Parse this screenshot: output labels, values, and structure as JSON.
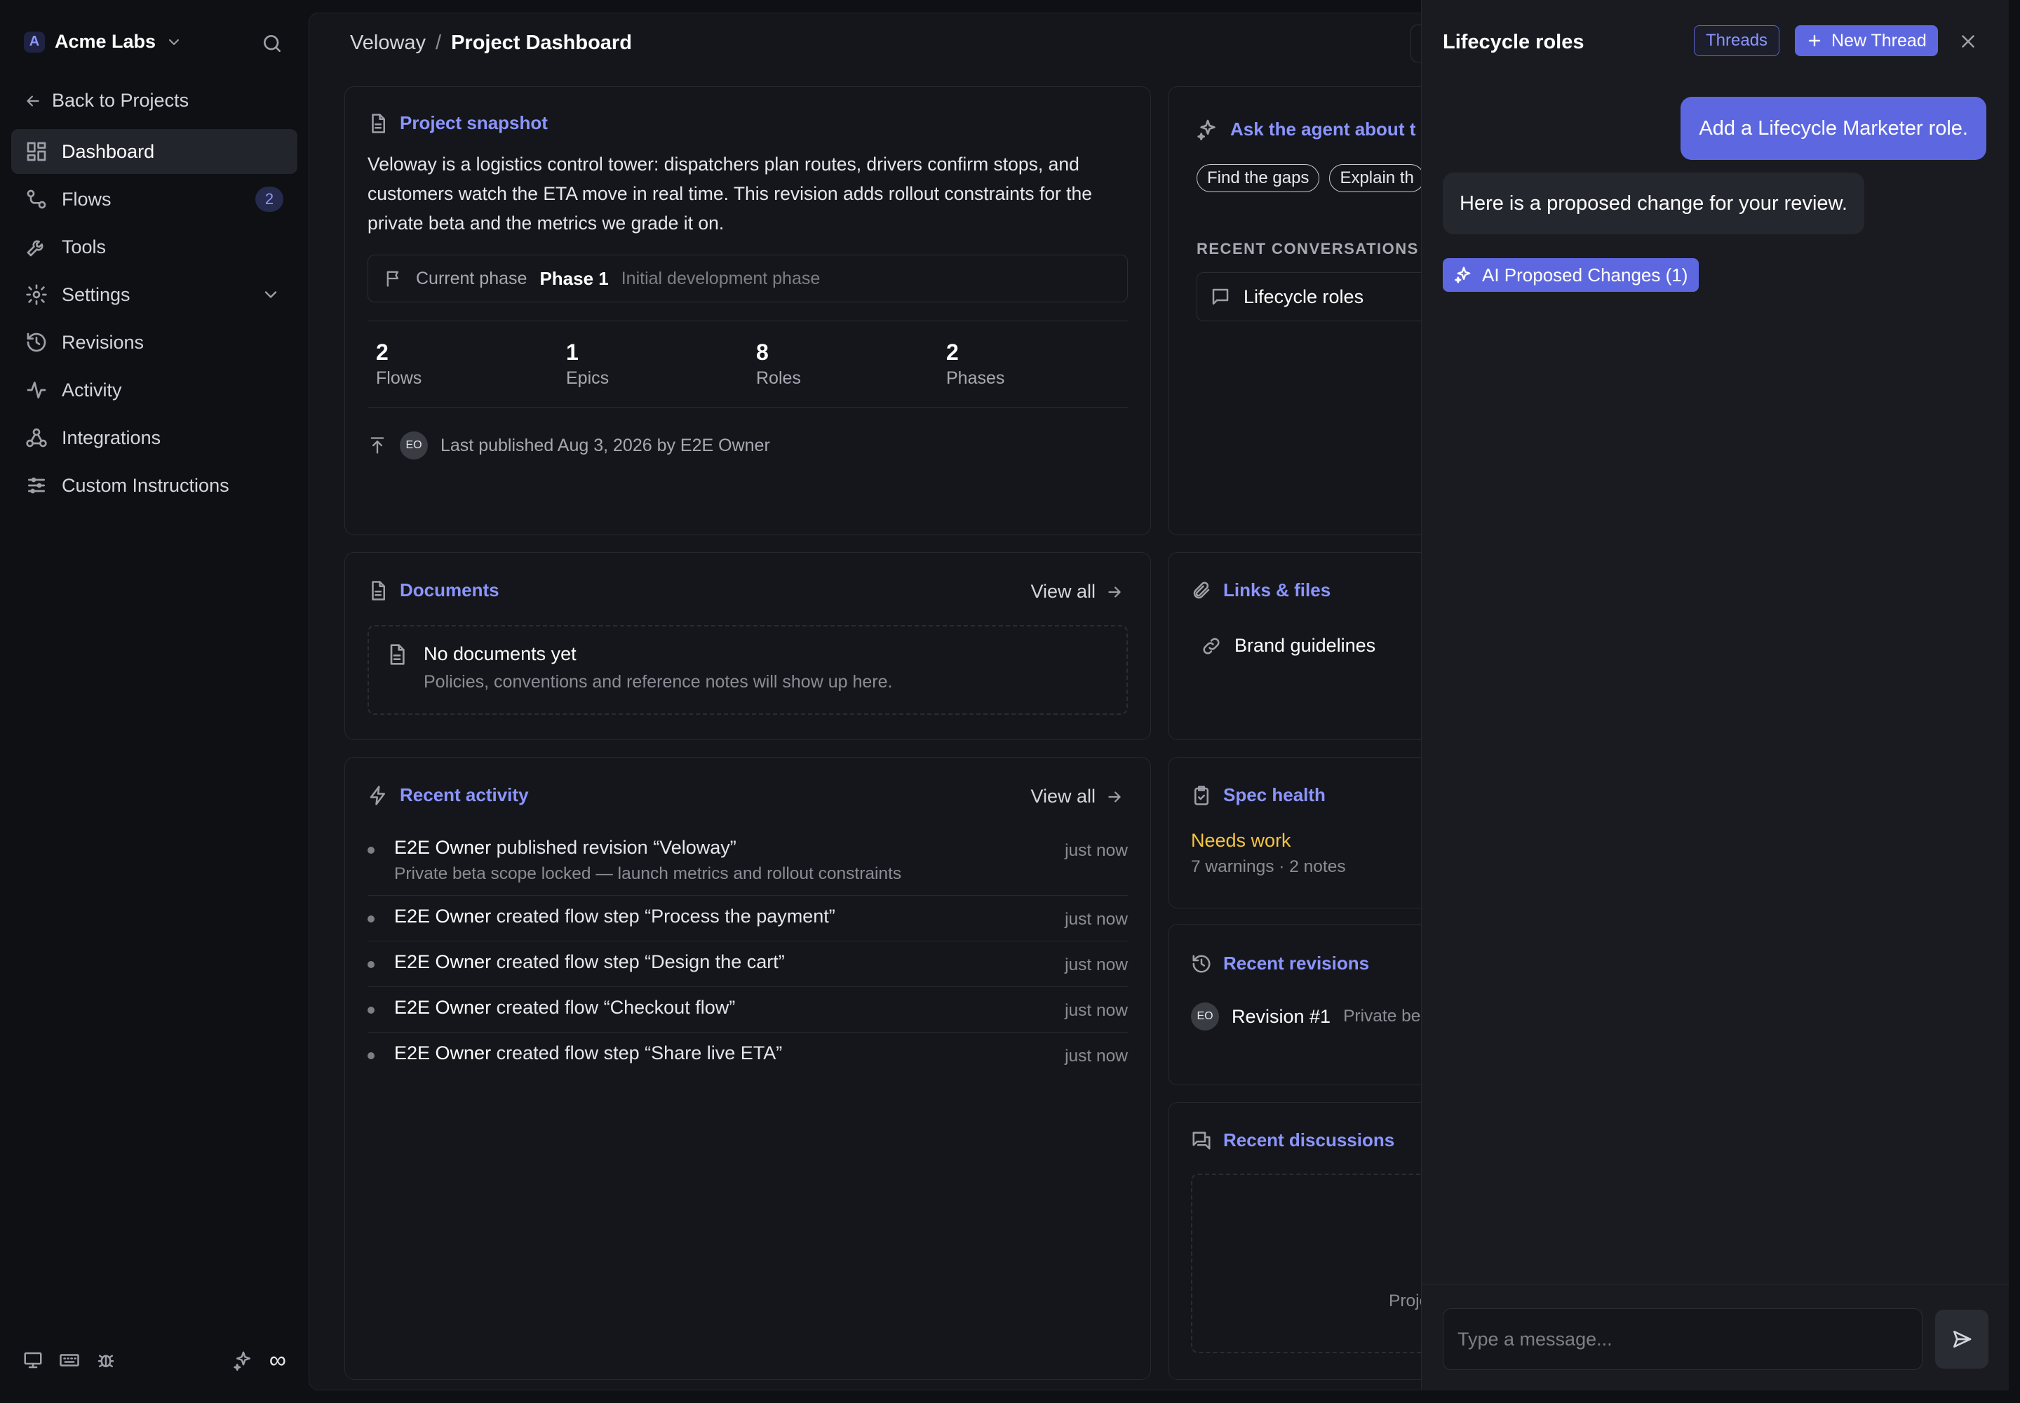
{
  "sidebar": {
    "org_initial": "A",
    "org_name": "Acme Labs",
    "back_label": "Back to Projects",
    "items": [
      {
        "label": "Dashboard"
      },
      {
        "label": "Flows",
        "badge": "2"
      },
      {
        "label": "Tools"
      },
      {
        "label": "Settings"
      },
      {
        "label": "Revisions"
      },
      {
        "label": "Activity"
      },
      {
        "label": "Integrations"
      },
      {
        "label": "Custom Instructions"
      }
    ],
    "footer_symbol": "∞"
  },
  "breadcrumb": {
    "project": "Veloway",
    "separator": "/",
    "page": "Project Dashboard"
  },
  "snapshot": {
    "title": "Project snapshot",
    "description": "Veloway is a logistics control tower: dispatchers plan routes, drivers confirm stops, and customers watch the ETA move in real time. This revision adds rollout constraints for the private beta and the metrics we grade it on.",
    "phase_label": "Current phase",
    "phase_name": "Phase 1",
    "phase_desc": "Initial development phase",
    "stats": [
      {
        "value": "2",
        "label": "Flows"
      },
      {
        "value": "1",
        "label": "Epics"
      },
      {
        "value": "8",
        "label": "Roles"
      },
      {
        "value": "2",
        "label": "Phases"
      }
    ],
    "publisher_initials": "EO",
    "published_text": "Last published Aug 3, 2026 by E2E Owner"
  },
  "agent": {
    "title": "Ask the agent about t",
    "chips": [
      "Find the gaps",
      "Explain th"
    ],
    "recent_label": "RECENT CONVERSATIONS",
    "recent_items": [
      "Lifecycle roles"
    ]
  },
  "documents": {
    "title": "Documents",
    "view_all": "View all",
    "empty_title": "No documents yet",
    "empty_sub": "Policies, conventions and reference notes will show up here."
  },
  "links": {
    "title": "Links & files",
    "items": [
      "Brand guidelines"
    ]
  },
  "activity": {
    "title": "Recent activity",
    "view_all": "View all",
    "items": [
      {
        "actor": "E2E Owner",
        "text": " published revision “Veloway”",
        "sub": "Private beta scope locked — launch metrics and rollout constraints",
        "time": "just now"
      },
      {
        "actor": "E2E Owner",
        "text": " created flow step “Process the payment”",
        "sub": "",
        "time": "just now"
      },
      {
        "actor": "E2E Owner",
        "text": " created flow step “Design the cart”",
        "sub": "",
        "time": "just now"
      },
      {
        "actor": "E2E Owner",
        "text": " created flow “Checkout flow”",
        "sub": "",
        "time": "just now"
      },
      {
        "actor": "E2E Owner",
        "text": " created flow step “Share live ETA”",
        "sub": "",
        "time": "just now"
      }
    ]
  },
  "spec_health": {
    "title": "Spec health",
    "status": "Needs work",
    "summary": "7 warnings · 2 notes",
    "status_color": "#f5c542"
  },
  "revisions": {
    "title": "Recent revisions",
    "initials": "EO",
    "name": "Revision #1",
    "desc": "Private be"
  },
  "discussions": {
    "title": "Recent discussions",
    "empty_text": "Proje"
  },
  "chat": {
    "title": "Lifecycle roles",
    "threads_label": "Threads",
    "new_thread_label": "New Thread",
    "user_message": "Add a Lifecycle Marketer role.",
    "agent_message": "Here is a proposed change for your review.",
    "proposed_label": "AI Proposed Changes (1)",
    "input_placeholder": "Type a message..."
  },
  "colors": {
    "accent": "#8b95ff",
    "primary_button": "#5d68e0",
    "background": "#0f1014",
    "panel": "#15161b"
  }
}
